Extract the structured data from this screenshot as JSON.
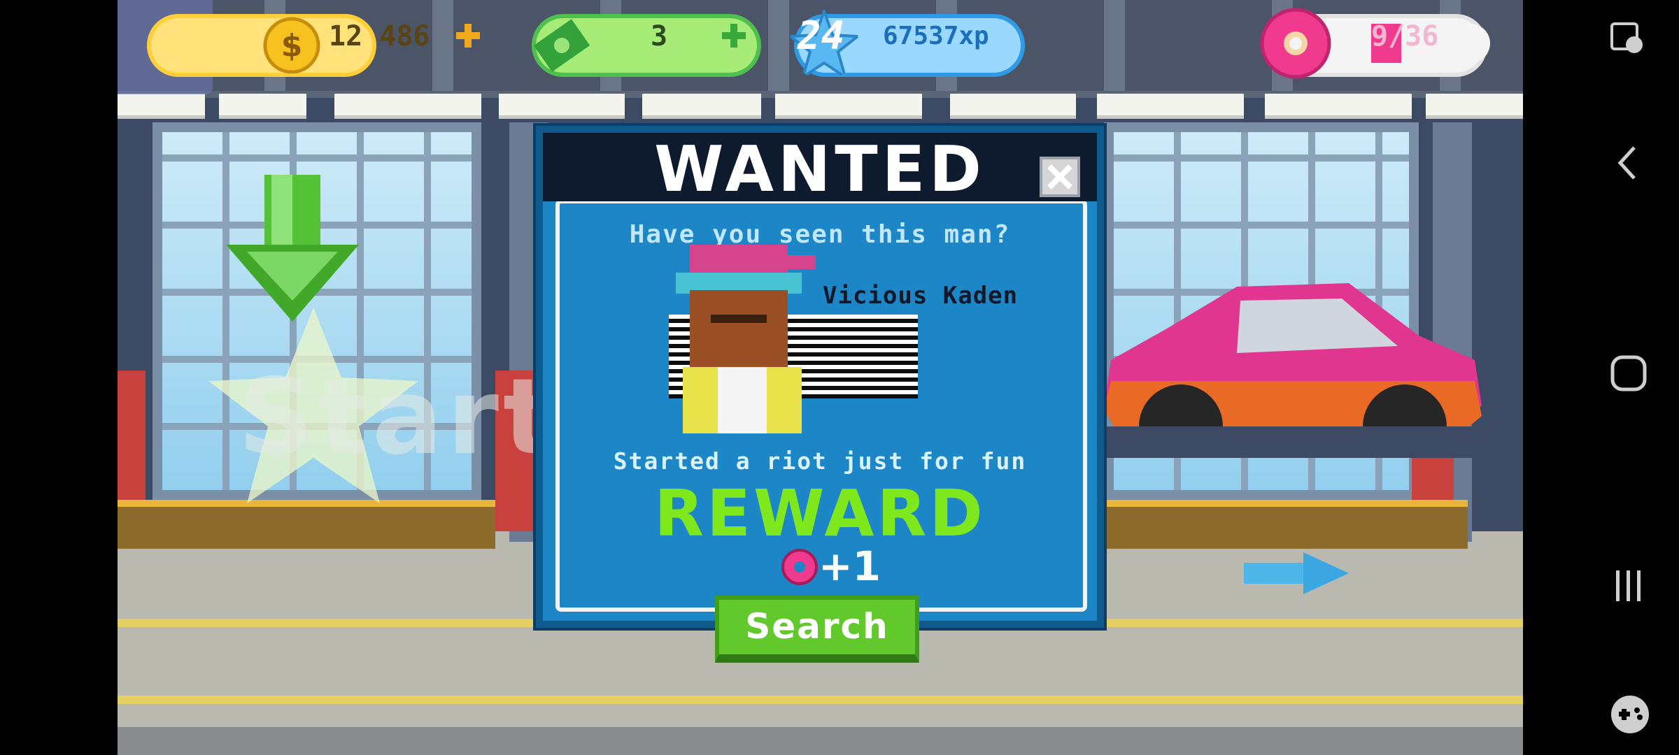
{
  "hud": {
    "coins": "12 486",
    "cash": "3",
    "level": "24",
    "xp": "67537xp",
    "donuts": "9/36",
    "donut_progress": 0.25
  },
  "background": {
    "start_label": "Start"
  },
  "dialog": {
    "title": "WANTED",
    "subtitle": "Have you seen this man?",
    "suspect_name": "Vicious Kaden",
    "crime": "Started a riot just for fun",
    "reward_label": "REWARD",
    "reward_amount": "+1",
    "search_label": "Search"
  },
  "colors": {
    "dialog_blue": "#1d86c6",
    "reward_green": "#7ee81d",
    "donut_pink": "#ef3a8d",
    "coin_gold": "#ffcf3a"
  },
  "system_nav": {
    "icons": [
      "screen-record-icon",
      "back-icon",
      "home-icon",
      "recents-icon",
      "game-tools-icon"
    ]
  }
}
